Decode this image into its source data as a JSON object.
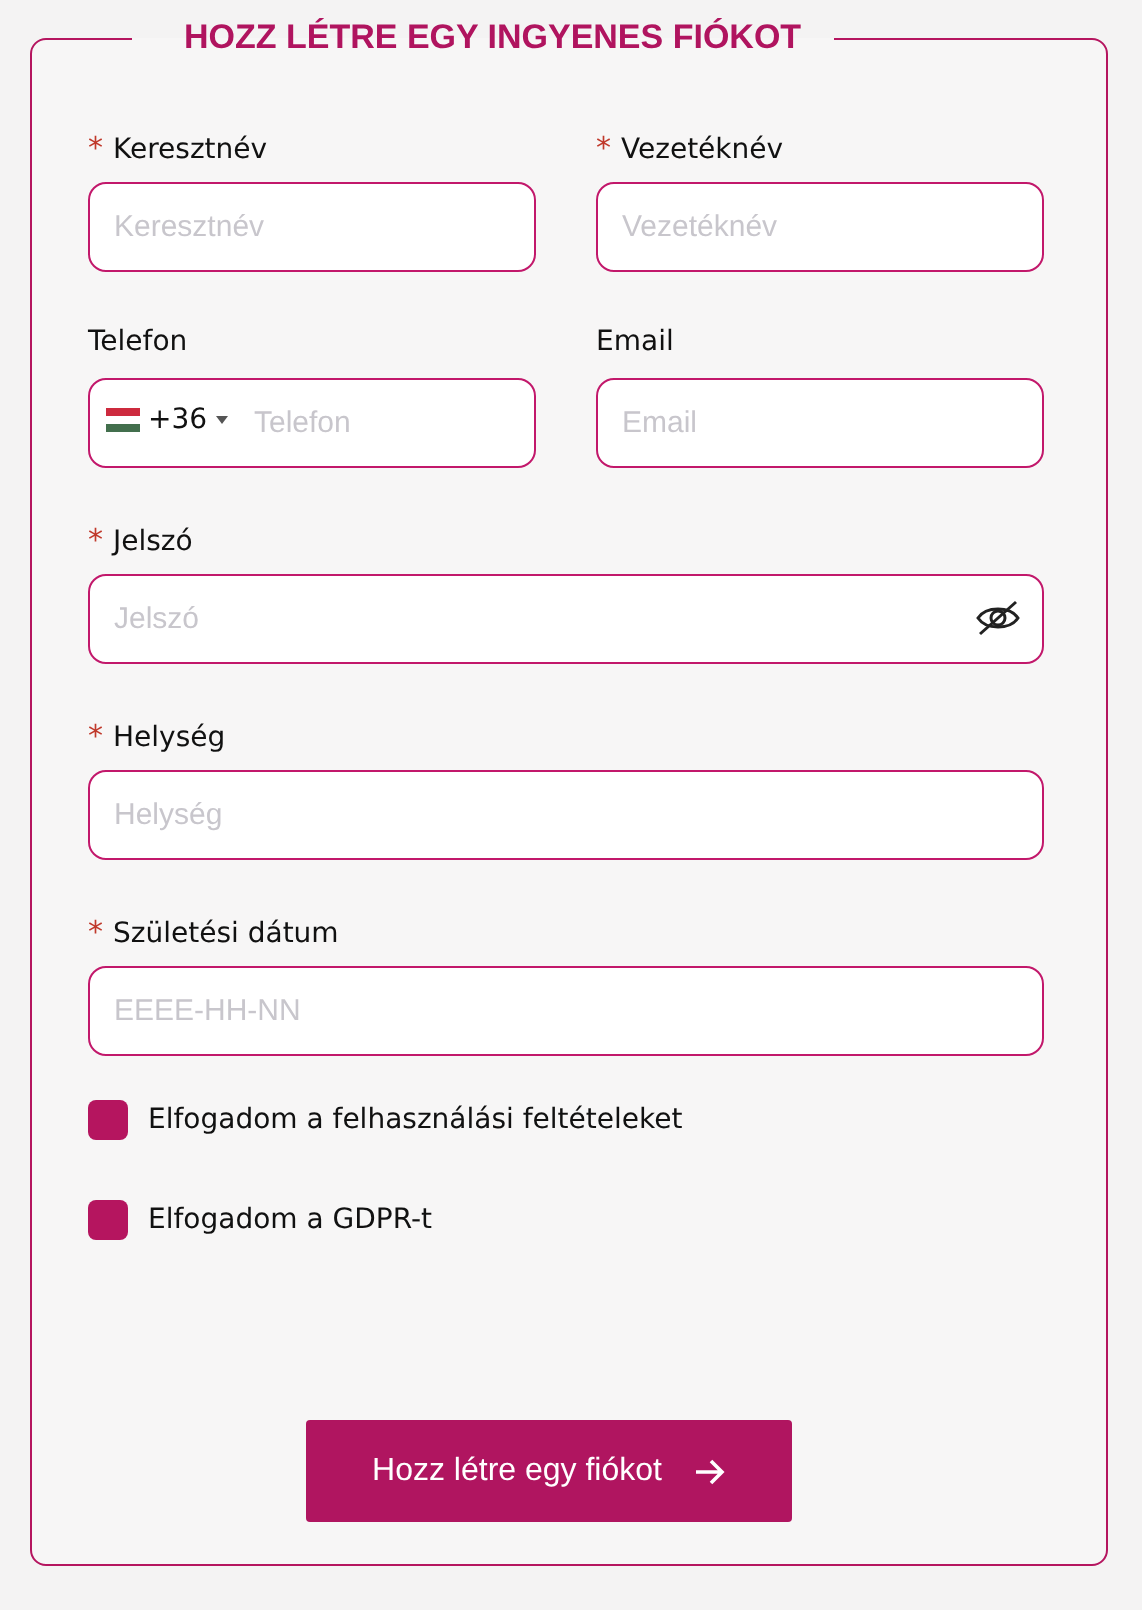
{
  "form": {
    "title": "HOZZ LÉTRE EGY INGYENES FIÓKOT",
    "fields": [
      {
        "kind": "text",
        "label": "Keresztnév",
        "required_mark": "*",
        "placeholder": "Keresztnév"
      },
      {
        "kind": "text",
        "label": "Vezetéknév",
        "required_mark": "*",
        "placeholder": "Vezetéknév"
      },
      {
        "kind": "phone",
        "label": "Telefon",
        "country_code": "+36",
        "placeholder": "Telefon"
      },
      {
        "kind": "text",
        "label": "Email",
        "placeholder": "Email"
      },
      {
        "kind": "password",
        "label": "Jelszó",
        "required_mark": "*",
        "placeholder": "Jelszó"
      },
      {
        "kind": "text",
        "label": "Helység",
        "required_mark": "*",
        "placeholder": "Helység"
      },
      {
        "kind": "text",
        "label": "Születési dátum",
        "required_mark": "*",
        "placeholder": "EEEE-HH-NN"
      }
    ],
    "checkboxes": [
      {
        "label": "Elfogadom a felhasználási feltételeket",
        "checked": false
      },
      {
        "label": "Elfogadom a GDPR-t",
        "checked": false
      }
    ],
    "submit": "Hozz létre egy fiókot"
  }
}
